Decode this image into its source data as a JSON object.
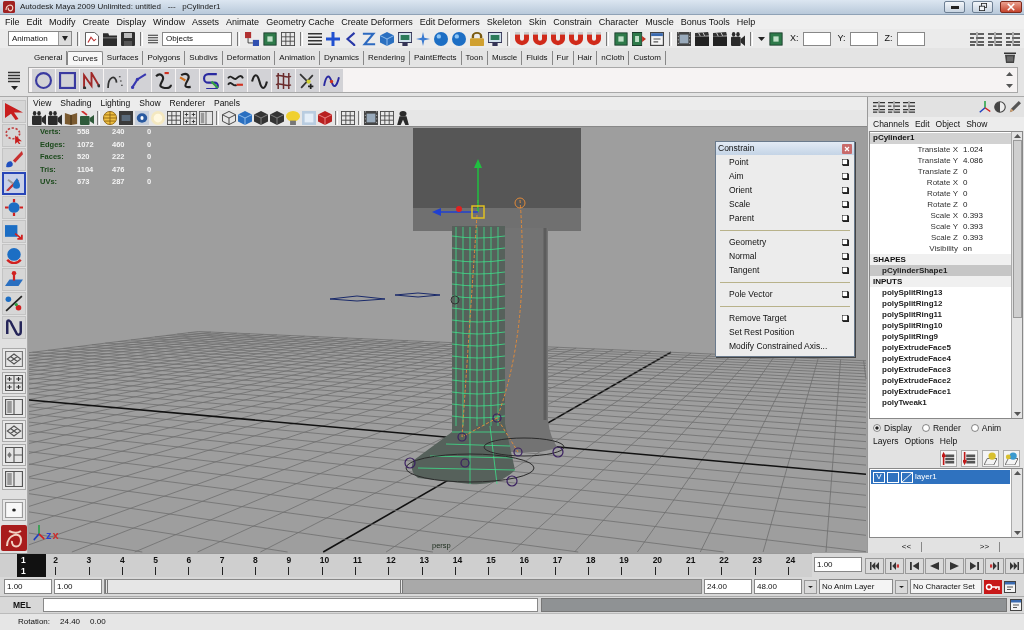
{
  "window": {
    "title": "Autodesk Maya 2009 Unlimited: untitled   ---   pCylinder1"
  },
  "menu_bar": [
    "File",
    "Edit",
    "Modify",
    "Create",
    "Display",
    "Window",
    "Assets",
    "Animate",
    "Geometry Cache",
    "Create Deformers",
    "Edit Deformers",
    "Skeleton",
    "Skin",
    "Constrain",
    "Character",
    "Muscle",
    "Bonus Tools",
    "Help"
  ],
  "status_line": {
    "menu_set": "Animation",
    "selection_field": "Objects",
    "transform_fields": [
      {
        "label": "X:"
      },
      {
        "label": "Y:"
      },
      {
        "label": "Z:"
      }
    ]
  },
  "shelf": {
    "tabs": [
      {
        "label": "General",
        "selected": false
      },
      {
        "label": "Curves",
        "selected": true
      },
      {
        "label": "Surfaces",
        "selected": false
      },
      {
        "label": "Polygons",
        "selected": false
      },
      {
        "label": "Subdivs",
        "selected": false
      },
      {
        "label": "Deformation",
        "selected": false
      },
      {
        "label": "Animation",
        "selected": false
      },
      {
        "label": "Dynamics",
        "selected": false
      },
      {
        "label": "Rendering",
        "selected": false
      },
      {
        "label": "PaintEffects",
        "selected": false
      },
      {
        "label": "Toon",
        "selected": false
      },
      {
        "label": "Muscle",
        "selected": false
      },
      {
        "label": "Fluids",
        "selected": false
      },
      {
        "label": "Fur",
        "selected": false
      },
      {
        "label": "Hair",
        "selected": false
      },
      {
        "label": "nCloth",
        "selected": false
      },
      {
        "label": "Custom",
        "selected": false
      }
    ]
  },
  "toolbox": {
    "tools": [
      {
        "selected": false
      },
      {
        "selected": false
      },
      {
        "selected": false
      },
      {
        "selected": true
      },
      {
        "selected": false
      },
      {
        "selected": false
      },
      {
        "selected": false
      },
      {
        "selected": false
      },
      {
        "selected": false
      },
      {
        "selected": false
      }
    ]
  },
  "viewport": {
    "menu": [
      "View",
      "Shading",
      "Lighting",
      "Show",
      "Renderer",
      "Panels"
    ],
    "hud": [
      {
        "label": "Verts:",
        "values": [
          "558",
          "240",
          "0"
        ]
      },
      {
        "label": "Edges:",
        "values": [
          "1072",
          "460",
          "0"
        ]
      },
      {
        "label": "Faces:",
        "values": [
          "520",
          "222",
          "0"
        ]
      },
      {
        "label": "Tris:",
        "values": [
          "1104",
          "476",
          "0"
        ]
      },
      {
        "label": "UVs:",
        "values": [
          "673",
          "287",
          "0"
        ]
      }
    ],
    "axis_labels": [
      {
        "label": "z",
        "color": "#2a3fd0"
      },
      {
        "label": "x",
        "color": "#d02a2a"
      }
    ],
    "camera": "persp",
    "constrain_menu": {
      "title": "Constrain",
      "sections": [
        [
          {
            "label": "Point",
            "option_box": true
          },
          {
            "label": "Aim",
            "option_box": true
          },
          {
            "label": "Orient",
            "option_box": true
          },
          {
            "label": "Scale",
            "option_box": true
          },
          {
            "label": "Parent",
            "option_box": true
          }
        ],
        [
          {
            "label": "Geometry",
            "option_box": true
          },
          {
            "label": "Normal",
            "option_box": true
          },
          {
            "label": "Tangent",
            "option_box": true
          }
        ],
        [
          {
            "label": "Pole Vector",
            "option_box": true
          }
        ],
        [
          {
            "label": "Remove Target",
            "option_box": true
          },
          {
            "label": "Set Rest Position",
            "option_box": false
          },
          {
            "label": "Modify Constrained Axis...",
            "option_box": false
          }
        ]
      ]
    }
  },
  "channel_box": {
    "menu": [
      "Channels",
      "Edit",
      "Object",
      "Show"
    ],
    "object": "pCylinder1",
    "attributes": [
      {
        "name": "Translate X",
        "value": "1.024"
      },
      {
        "name": "Translate Y",
        "value": "4.086"
      },
      {
        "name": "Translate Z",
        "value": "0"
      },
      {
        "name": "Rotate X",
        "value": "0"
      },
      {
        "name": "Rotate Y",
        "value": "0"
      },
      {
        "name": "Rotate Z",
        "value": "0"
      },
      {
        "name": "Scale X",
        "value": "0.393"
      },
      {
        "name": "Scale Y",
        "value": "0.393"
      },
      {
        "name": "Scale Z",
        "value": "0.393"
      },
      {
        "name": "Visibility",
        "value": "on"
      }
    ],
    "shapes_heading": "SHAPES",
    "shapes": [
      {
        "name": "pCylinderShape1",
        "selected": true
      }
    ],
    "inputs_heading": "INPUTS",
    "inputs": [
      "polySplitRing13",
      "polySplitRing12",
      "polySplitRing11",
      "polySplitRing10",
      "polySplitRing9",
      "polyExtrudeFace5",
      "polyExtrudeFace4",
      "polyExtrudeFace3",
      "polyExtrudeFace2",
      "polyExtrudeFace1",
      "polyTweak1"
    ]
  },
  "layer_editor": {
    "modes": [
      {
        "label": "Display",
        "selected": true
      },
      {
        "label": "Render",
        "selected": false
      },
      {
        "label": "Anim",
        "selected": false
      }
    ],
    "menu": [
      "Layers",
      "Options",
      "Help"
    ],
    "layers": [
      {
        "visibility": "V",
        "name": "layer1",
        "selected": true
      }
    ],
    "nav": [
      "<<",
      ">>"
    ]
  },
  "time_slider": {
    "frames": [
      {
        "label": "1",
        "selected": true
      },
      {
        "label": "2",
        "selected": false
      },
      {
        "label": "3",
        "selected": false
      },
      {
        "label": "4",
        "selected": false
      },
      {
        "label": "5",
        "selected": false
      },
      {
        "label": "6",
        "selected": false
      },
      {
        "label": "7",
        "selected": false
      },
      {
        "label": "8",
        "selected": false
      },
      {
        "label": "9",
        "selected": false
      },
      {
        "label": "10",
        "selected": false
      },
      {
        "label": "11",
        "selected": false
      },
      {
        "label": "12",
        "selected": false
      },
      {
        "label": "13",
        "selected": false
      },
      {
        "label": "14",
        "selected": false
      },
      {
        "label": "15",
        "selected": false
      },
      {
        "label": "16",
        "selected": false
      },
      {
        "label": "17",
        "selected": false
      },
      {
        "label": "18",
        "selected": false
      },
      {
        "label": "19",
        "selected": false
      },
      {
        "label": "20",
        "selected": false
      },
      {
        "label": "21",
        "selected": false
      },
      {
        "label": "22",
        "selected": false
      },
      {
        "label": "23",
        "selected": false
      },
      {
        "label": "24",
        "selected": false
      }
    ],
    "current_frame": "1",
    "current_time": "1.00"
  },
  "range_slider": {
    "start_time": "1.00",
    "playback_start": "1.00",
    "level": 0.5,
    "playback_end": "24.00",
    "end_time": "48.00",
    "anim_layer": "No Anim Layer",
    "character_set": "No Character Set"
  },
  "command_line": {
    "language": "MEL"
  },
  "help_line": {
    "label": "Rotation:",
    "values": [
      "24.40",
      "0.00"
    ]
  }
}
